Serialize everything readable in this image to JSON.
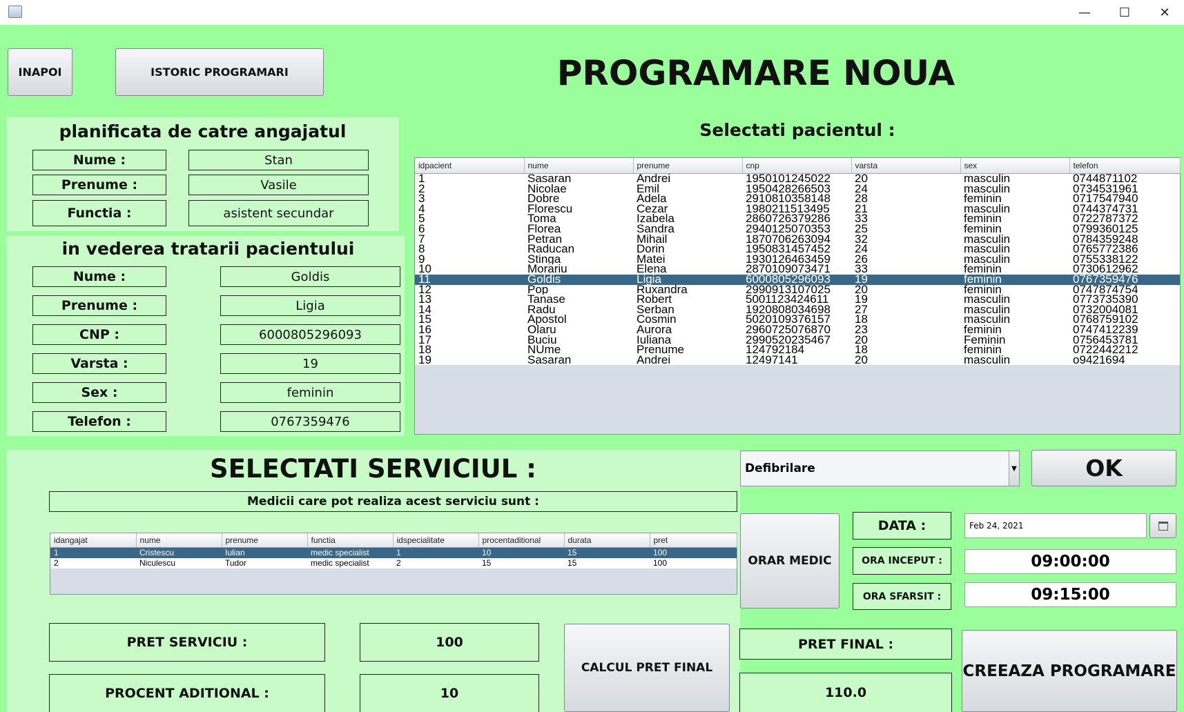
{
  "window": {
    "minimize": "—",
    "maximize": "☐",
    "close": "✕"
  },
  "nav": {
    "back_label": "INAPOI",
    "history_label": "ISTORIC PROGRAMARI"
  },
  "page_title": "PROGRAMARE NOUA",
  "employee": {
    "heading": "planificata de catre angajatul",
    "labels": {
      "nume": "Nume :",
      "prenume": "Prenume :",
      "functia": "Functia :"
    },
    "values": {
      "nume": "Stan",
      "prenume": "Vasile",
      "functia": "asistent secundar"
    }
  },
  "patient": {
    "heading": "in vederea tratarii pacientului",
    "labels": {
      "nume": "Nume :",
      "prenume": "Prenume :",
      "cnp": "CNP :",
      "varsta": "Varsta :",
      "sex": "Sex :",
      "telefon": "Telefon :"
    },
    "values": {
      "nume": "Goldis",
      "prenume": "Ligia",
      "cnp": "6000805296093",
      "varsta": "19",
      "sex": "feminin",
      "telefon": "0767359476"
    }
  },
  "patients_table": {
    "heading": "Selectati pacientul :",
    "columns": [
      "idpacient",
      "nume",
      "prenume",
      "cnp",
      "varsta",
      "sex",
      "telefon"
    ],
    "selected_index": 10,
    "rows": [
      [
        "1",
        "Sasaran",
        "Andrei",
        "1950101245022",
        "20",
        "masculin",
        "0744871102"
      ],
      [
        "2",
        "Nicolae",
        "Emil",
        "1950428266503",
        "24",
        "masculin",
        "0734531961"
      ],
      [
        "3",
        "Dobre",
        "Adela",
        "2910810358148",
        "28",
        "feminin",
        "0717547940"
      ],
      [
        "4",
        "Florescu",
        "Cezar",
        "1980211513495",
        "21",
        "masculin",
        "0744374731"
      ],
      [
        "5",
        "Toma",
        "Izabela",
        "2860726379286",
        "33",
        "feminin",
        "0722787372"
      ],
      [
        "6",
        "Florea",
        "Sandra",
        "2940125070353",
        "25",
        "feminin",
        "0799360125"
      ],
      [
        "7",
        "Petran",
        "Mihail",
        "1870706263094",
        "32",
        "masculin",
        "0784359248"
      ],
      [
        "8",
        "Raducan",
        "Dorin",
        "1950831457452",
        "24",
        "masculin",
        "0765772386"
      ],
      [
        "9",
        "Stinga",
        "Matei",
        "1930126463459",
        "26",
        "masculin",
        "0755338122"
      ],
      [
        "10",
        "Morariu",
        "Elena",
        "2870109073471",
        "33",
        "feminin",
        "0730612962"
      ],
      [
        "11",
        "Goldis",
        "Ligia",
        "6000805296093",
        "19",
        "feminin",
        "0767359476"
      ],
      [
        "12",
        "Pop",
        "Ruxandra",
        "2990913107025",
        "20",
        "feminin",
        "0747874754"
      ],
      [
        "13",
        "Tanase",
        "Robert",
        "5001123424611",
        "19",
        "masculin",
        "0773735390"
      ],
      [
        "14",
        "Radu",
        "Serban",
        "1920808034698",
        "27",
        "masculin",
        "0732004081"
      ],
      [
        "15",
        "Apostol",
        "Cosmin",
        "5020109376157",
        "18",
        "masculin",
        "0768759102"
      ],
      [
        "16",
        "Olaru",
        "Aurora",
        "2960725076870",
        "23",
        "feminin",
        "0747412239"
      ],
      [
        "17",
        "Buciu",
        "Iuliana",
        "2990520235467",
        "20",
        "Feminin",
        "0756453781"
      ],
      [
        "18",
        "NUme",
        "Prenume",
        "124792184",
        "18",
        "feminin",
        "0722442212"
      ],
      [
        "19",
        "Sasaran",
        "Andrei",
        "12497141",
        "20",
        "masculin",
        "o9421694"
      ]
    ]
  },
  "service": {
    "heading": "SELECTATI SERVICIUL :",
    "selected": "Defibrilare",
    "ok_label": "OK",
    "doctors_caption": "Medicii care pot realiza acest serviciu sunt :"
  },
  "doctors_table": {
    "columns": [
      "idangajat",
      "nume",
      "prenume",
      "functia",
      "idspecialitate",
      "procentaditional",
      "durata",
      "pret"
    ],
    "selected_index": 0,
    "rows": [
      [
        "1",
        "Cristescu",
        "Iulian",
        "medic specialist",
        "1",
        "10",
        "15",
        "100"
      ],
      [
        "2",
        "Niculescu",
        "Tudor",
        "medic specialist",
        "2",
        "15",
        "15",
        "100"
      ]
    ]
  },
  "schedule": {
    "orar_label": "ORAR MEDIC",
    "data_label": "DATA :",
    "date_value": "Feb 24, 2021",
    "ora_inceput_label": "ORA INCEPUT :",
    "ora_inceput_value": "09:00:00",
    "ora_sfarsit_label": "ORA SFARSIT :",
    "ora_sfarsit_value": "09:15:00"
  },
  "pricing": {
    "pret_serviciu_label": "PRET SERVICIU :",
    "pret_serviciu_value": "100",
    "procent_label": "PROCENT ADITIONAL :",
    "procent_value": "10",
    "calc_label": "CALCUL PRET FINAL",
    "pret_final_label": "PRET FINAL :",
    "pret_final_value": "110.0",
    "create_label": "CREEAZA PROGRAMARE"
  },
  "colors": {
    "background": "#9aff9a",
    "panel": "#c8fbc8",
    "selection": "#3a6788"
  }
}
